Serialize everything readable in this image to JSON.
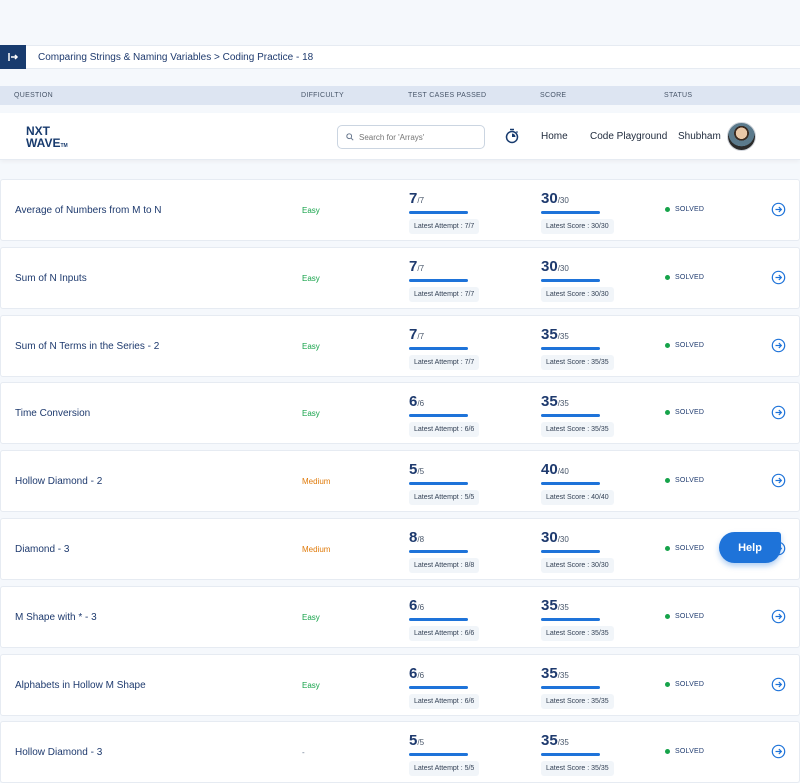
{
  "breadcrumb": "Comparing Strings & Naming Variables > Coding Practice - 18",
  "columns": {
    "question": "QUESTION",
    "difficulty": "DIFFICULTY",
    "test_cases": "TEST CASES PASSED",
    "score": "SCORE",
    "status": "STATUS"
  },
  "navbar": {
    "logo_line1": "NXT",
    "logo_line2": "WAVE",
    "logo_tm": "TM",
    "search_placeholder": "Search for 'Arrays'",
    "home": "Home",
    "code_playground": "Code Playground",
    "user_name": "Shubham"
  },
  "rows": [
    {
      "title": "Average of Numbers from M to N",
      "difficulty": "Easy",
      "tests_passed": "7",
      "tests_total": "/7",
      "latest_attempt": "Latest Attempt : 7/7",
      "score": "30",
      "score_total": "/30",
      "latest_score": "Latest Score : 30/30",
      "status": "SOLVED"
    },
    {
      "title": "Sum of N Inputs",
      "difficulty": "Easy",
      "tests_passed": "7",
      "tests_total": "/7",
      "latest_attempt": "Latest Attempt : 7/7",
      "score": "30",
      "score_total": "/30",
      "latest_score": "Latest Score : 30/30",
      "status": "SOLVED"
    },
    {
      "title": "Sum of N Terms in the Series - 2",
      "difficulty": "Easy",
      "tests_passed": "7",
      "tests_total": "/7",
      "latest_attempt": "Latest Attempt : 7/7",
      "score": "35",
      "score_total": "/35",
      "latest_score": "Latest Score : 35/35",
      "status": "SOLVED"
    },
    {
      "title": "Time Conversion",
      "difficulty": "Easy",
      "tests_passed": "6",
      "tests_total": "/6",
      "latest_attempt": "Latest Attempt : 6/6",
      "score": "35",
      "score_total": "/35",
      "latest_score": "Latest Score : 35/35",
      "status": "SOLVED"
    },
    {
      "title": "Hollow Diamond - 2",
      "difficulty": "Medium",
      "tests_passed": "5",
      "tests_total": "/5",
      "latest_attempt": "Latest Attempt : 5/5",
      "score": "40",
      "score_total": "/40",
      "latest_score": "Latest Score : 40/40",
      "status": "SOLVED"
    },
    {
      "title": "Diamond - 3",
      "difficulty": "Medium",
      "tests_passed": "8",
      "tests_total": "/8",
      "latest_attempt": "Latest Attempt : 8/8",
      "score": "30",
      "score_total": "/30",
      "latest_score": "Latest Score : 30/30",
      "status": "SOLVED"
    },
    {
      "title": "M Shape with * - 3",
      "difficulty": "Easy",
      "tests_passed": "6",
      "tests_total": "/6",
      "latest_attempt": "Latest Attempt : 6/6",
      "score": "35",
      "score_total": "/35",
      "latest_score": "Latest Score : 35/35",
      "status": "SOLVED"
    },
    {
      "title": "Alphabets in Hollow M Shape",
      "difficulty": "Easy",
      "tests_passed": "6",
      "tests_total": "/6",
      "latest_attempt": "Latest Attempt : 6/6",
      "score": "35",
      "score_total": "/35",
      "latest_score": "Latest Score : 35/35",
      "status": "SOLVED"
    },
    {
      "title": "Hollow Diamond - 3",
      "difficulty": "-",
      "tests_passed": "5",
      "tests_total": "/5",
      "latest_attempt": "Latest Attempt : 5/5",
      "score": "35",
      "score_total": "/35",
      "latest_score": "Latest Score : 35/35",
      "status": "SOLVED"
    }
  ],
  "help_label": "Help",
  "icons": [
    "collapse-sidebar-icon",
    "search-icon",
    "timer-icon",
    "arrow-right-circle-icon"
  ],
  "colors": {
    "brand_navy": "#183b6e",
    "accent_blue": "#1e73d9",
    "easy_green": "#16a34a",
    "medium_orange": "#e07b0b"
  }
}
